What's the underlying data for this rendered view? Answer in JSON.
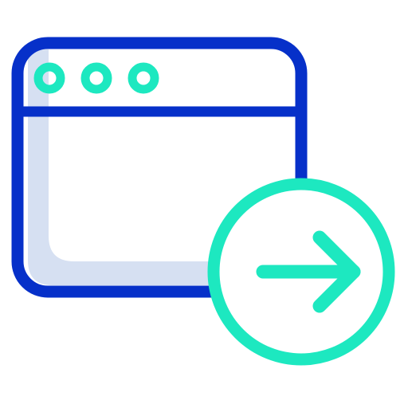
{
  "icon": {
    "name": "browser-window-with-arrow-right-icon",
    "colors": {
      "frame": "#0630c9",
      "accent": "#1de8c0",
      "shade": "#d6e0f2",
      "background": "#ffffff"
    },
    "window": {
      "dots": [
        "window-dot-1",
        "window-dot-2",
        "window-dot-3"
      ]
    },
    "badge": {
      "glyph": "arrow-right-icon"
    }
  }
}
